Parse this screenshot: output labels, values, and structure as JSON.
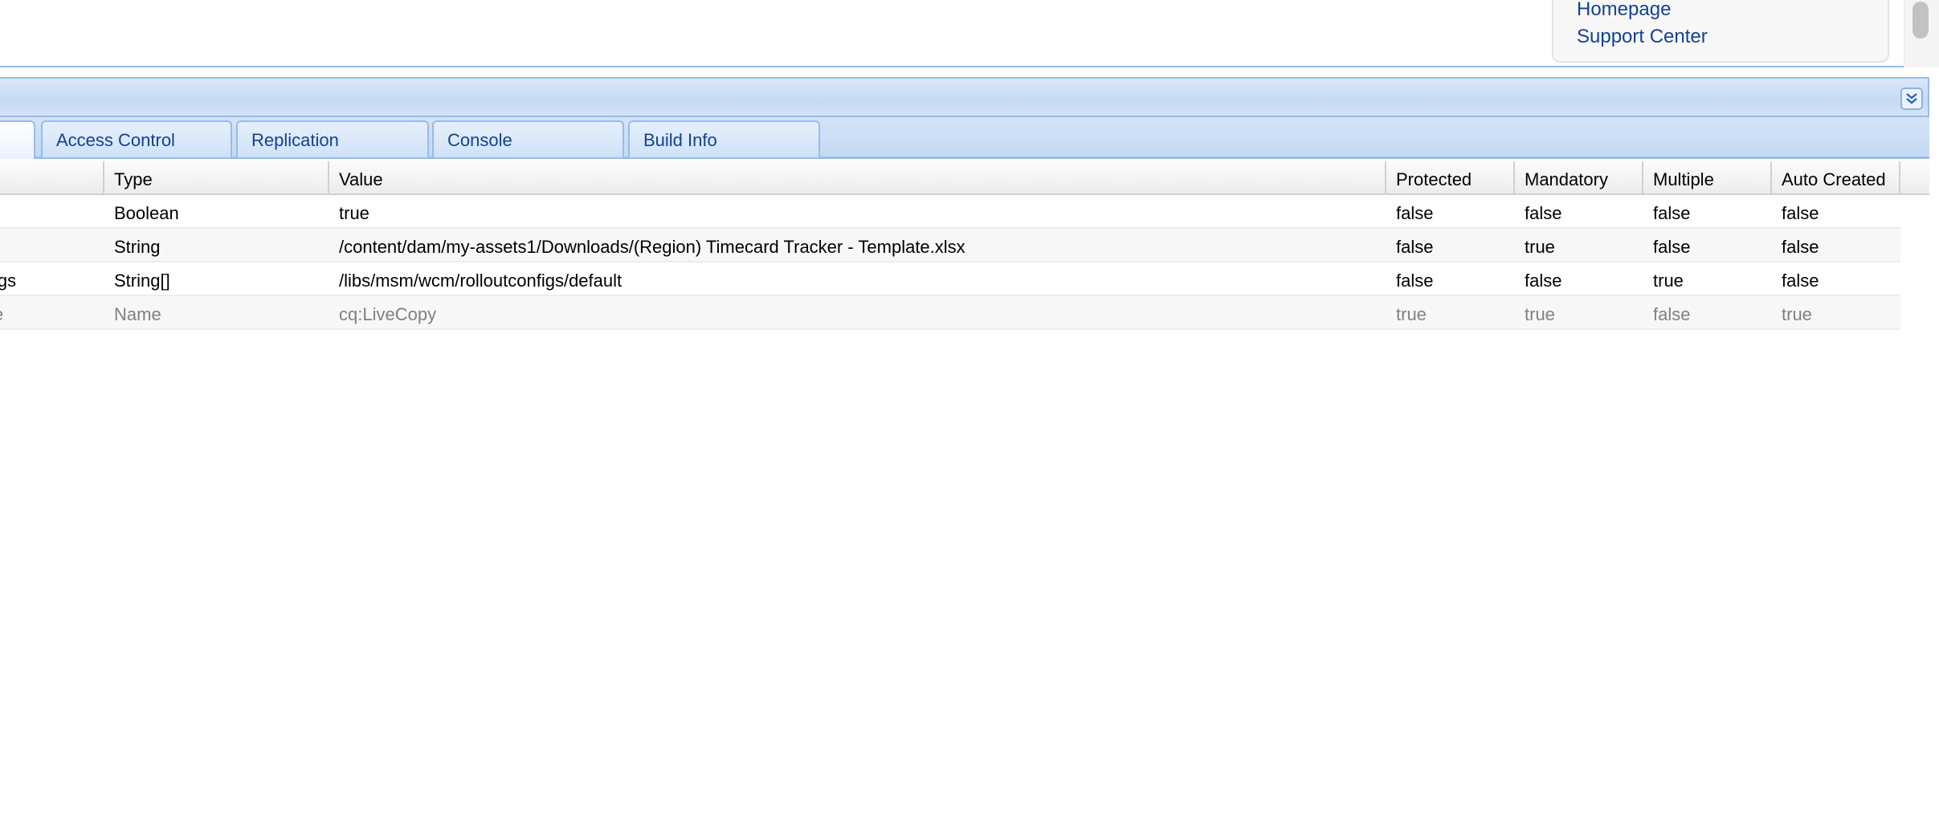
{
  "links": {
    "homepage": "Homepage",
    "support_center": "Support Center"
  },
  "tabs": [
    {
      "label": "",
      "active": true
    },
    {
      "label": "Access Control",
      "active": false
    },
    {
      "label": "Replication",
      "active": false
    },
    {
      "label": "Console",
      "active": false
    },
    {
      "label": "Build Info",
      "active": false
    }
  ],
  "icons": {
    "collapse": "double-chevron-down-icon"
  },
  "grid": {
    "columns": [
      "",
      "Type",
      "Value",
      "Protected",
      "Mandatory",
      "Multiple",
      "Auto Created"
    ],
    "rows": [
      {
        "name": "",
        "type": "Boolean",
        "value": "true",
        "protected": "false",
        "mandatory": "false",
        "multiple": "false",
        "auto_created": "false",
        "muted": false
      },
      {
        "name": "",
        "type": "String",
        "value": "/content/dam/my-assets1/Downloads/(Region) Timecard Tracker - Template.xlsx",
        "protected": "false",
        "mandatory": "true",
        "multiple": "false",
        "auto_created": "false",
        "muted": false
      },
      {
        "name": "igs",
        "type": "String[]",
        "value": "/libs/msm/wcm/rolloutconfigs/default",
        "protected": "false",
        "mandatory": "false",
        "multiple": "true",
        "auto_created": "false",
        "muted": false
      },
      {
        "name": "e",
        "type": "Name",
        "value": "cq:LiveCopy",
        "protected": "true",
        "mandatory": "true",
        "multiple": "false",
        "auto_created": "true",
        "muted": true
      }
    ]
  },
  "colors": {
    "link": "#15428b",
    "border": "#99bbe8",
    "muted_text": "#808080"
  }
}
